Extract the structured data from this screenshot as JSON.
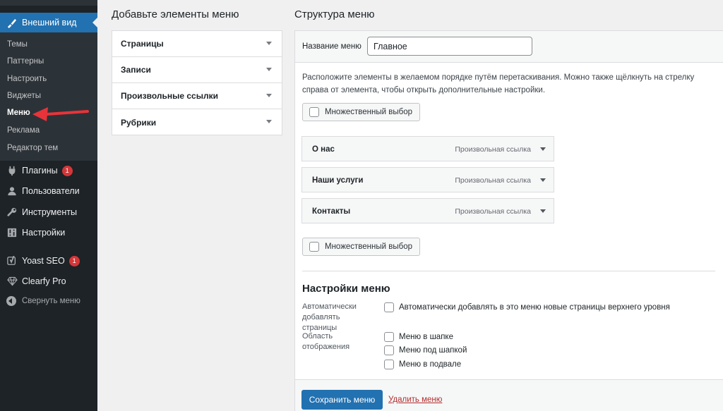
{
  "sidebar": {
    "current_section": "Внешний вид",
    "submenu": [
      "Темы",
      "Паттерны",
      "Настроить",
      "Виджеты",
      "Меню",
      "Реклама",
      "Редактор тем"
    ],
    "selected_submenu": "Меню",
    "items": [
      {
        "label": "Плагины",
        "icon": "plugin-icon",
        "badge": "1"
      },
      {
        "label": "Пользователи",
        "icon": "users-icon",
        "badge": ""
      },
      {
        "label": "Инструменты",
        "icon": "wrench-icon",
        "badge": ""
      },
      {
        "label": "Настройки",
        "icon": "settings-icon",
        "badge": ""
      },
      {
        "label": "Yoast SEO",
        "icon": "yoast-icon",
        "badge": "1"
      },
      {
        "label": "Clearfy Pro",
        "icon": "diamond-icon",
        "badge": ""
      }
    ],
    "collapse_label": "Свернуть меню"
  },
  "add_items": {
    "heading": "Добавьте элементы меню",
    "panels": [
      "Страницы",
      "Записи",
      "Произвольные ссылки",
      "Рубрики"
    ]
  },
  "structure": {
    "heading": "Структура меню",
    "name_label": "Название меню",
    "name_value": "Главное",
    "instructions": "Расположите элементы в желаемом порядке путём перетаскивания. Можно также щёлкнуть на стрелку справа от элемента, чтобы открыть дополнительные настройки.",
    "bulk_select_label": "Множественный выбор",
    "items": [
      {
        "title": "О нас",
        "type": "Произвольная ссылка"
      },
      {
        "title": "Наши услуги",
        "type": "Произвольная ссылка"
      },
      {
        "title": "Контакты",
        "type": "Произвольная ссылка"
      }
    ]
  },
  "menu_settings": {
    "title": "Настройки меню",
    "auto_add_label": "Автоматически добавлять страницы",
    "auto_add_option": "Автоматически добавлять в это меню новые страницы верхнего уровня",
    "locations_label": "Область отображения",
    "locations": [
      "Меню в шапке",
      "Меню под шапкой",
      "Меню в подвале"
    ]
  },
  "actions": {
    "save_label": "Сохранить меню",
    "delete_label": "Удалить меню"
  },
  "colors": {
    "sidebar_bg": "#1d2327",
    "accent": "#2271b1",
    "badge": "#d63638",
    "annotation_arrow": "#e8333a",
    "delete_link": "#b32d2e"
  }
}
